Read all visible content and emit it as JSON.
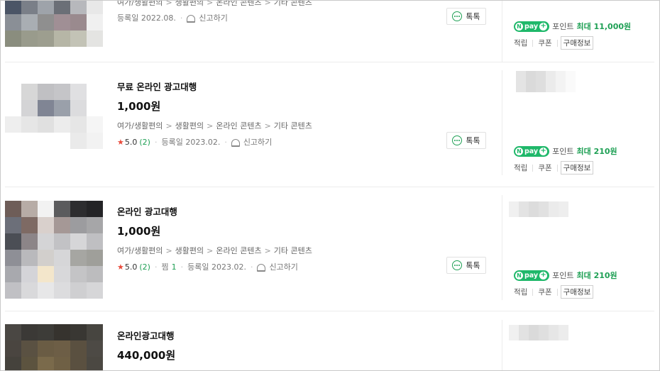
{
  "listings": [
    {
      "title": "",
      "price": "",
      "categories": [
        "여가/생활편의",
        "생활편의",
        "온라인 콘텐츠",
        "기타 콘텐츠"
      ],
      "rating": "",
      "review_count": "",
      "wish_label": "",
      "wish_count": "",
      "reg_date": "등록일 2022.08.",
      "report_label": "신고하기",
      "talk_label": "톡톡",
      "naverpay_label": "pay",
      "point_label": "포인트",
      "point_value": "최대 11,000원",
      "link_earn": "적립",
      "link_coupon": "쿠폰",
      "link_purchase": "구매정보"
    },
    {
      "title": "무료 온라인 광고대행",
      "price": "1,000원",
      "categories": [
        "여가/생활편의",
        "생활편의",
        "온라인 콘텐츠",
        "기타 콘텐츠"
      ],
      "rating": "5.0",
      "review_count": "(2)",
      "wish_label": "",
      "wish_count": "",
      "reg_date": "등록일 2023.02.",
      "report_label": "신고하기",
      "talk_label": "톡톡",
      "naverpay_label": "pay",
      "point_label": "포인트",
      "point_value": "최대 210원",
      "link_earn": "적립",
      "link_coupon": "쿠폰",
      "link_purchase": "구매정보"
    },
    {
      "title": "온라인 광고대행",
      "price": "1,000원",
      "categories": [
        "여가/생활편의",
        "생활편의",
        "온라인 콘텐츠",
        "기타 콘텐츠"
      ],
      "rating": "5.0",
      "review_count": "(2)",
      "wish_label": "찜",
      "wish_count": "1",
      "reg_date": "등록일 2023.02.",
      "report_label": "신고하기",
      "talk_label": "톡톡",
      "naverpay_label": "pay",
      "point_label": "포인트",
      "point_value": "최대 210원",
      "link_earn": "적립",
      "link_coupon": "쿠폰",
      "link_purchase": "구매정보"
    },
    {
      "title": "온라인광고대행",
      "price": "440,000원"
    }
  ],
  "colors": {
    "naver_green": "#1fa055",
    "pay_green": "#1fb86a",
    "star_red": "#e94b3c"
  },
  "icons": [
    "chat-bubble-icon",
    "report-bell-icon",
    "star-icon",
    "naverpay-icon"
  ]
}
